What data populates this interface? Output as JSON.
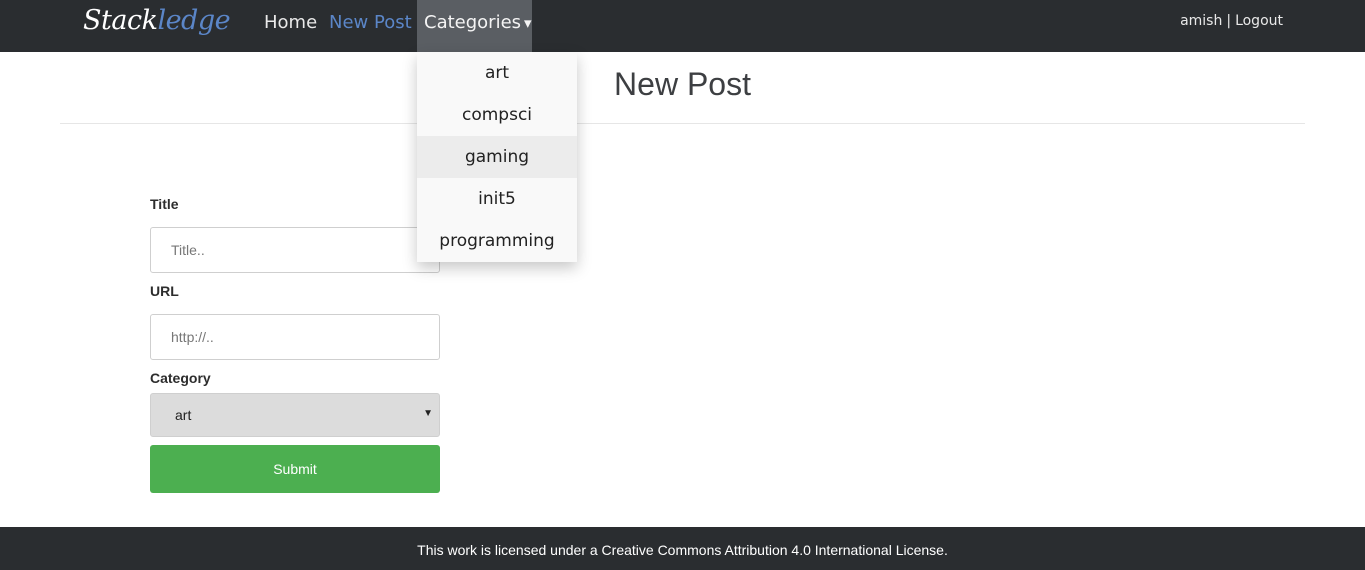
{
  "nav": {
    "brand_part1": "Stack",
    "brand_part2": "ledge",
    "home": "Home",
    "new_post": "New Post",
    "categories": "Categories",
    "caret": "▾",
    "username": "amish",
    "separator": "|",
    "logout": "Logout"
  },
  "colors": {
    "nav_bg": "#2a2d30",
    "accent_blue": "#5b86c8",
    "submit_green": "#4caf50",
    "active_nav_bg": "#5a5e63"
  },
  "dropdown": {
    "items": [
      "art",
      "compsci",
      "gaming",
      "init5",
      "programming"
    ],
    "highlighted": "gaming"
  },
  "page": {
    "title": "New Post"
  },
  "form": {
    "title_label": "Title",
    "title_placeholder": "Title..",
    "url_label": "URL",
    "url_placeholder": "http://..",
    "category_label": "Category",
    "category_selected": "art",
    "select_arrow": "▼",
    "submit_label": "Submit"
  },
  "footer": {
    "text": "This work is licensed under a Creative Commons Attribution 4.0 International License."
  }
}
